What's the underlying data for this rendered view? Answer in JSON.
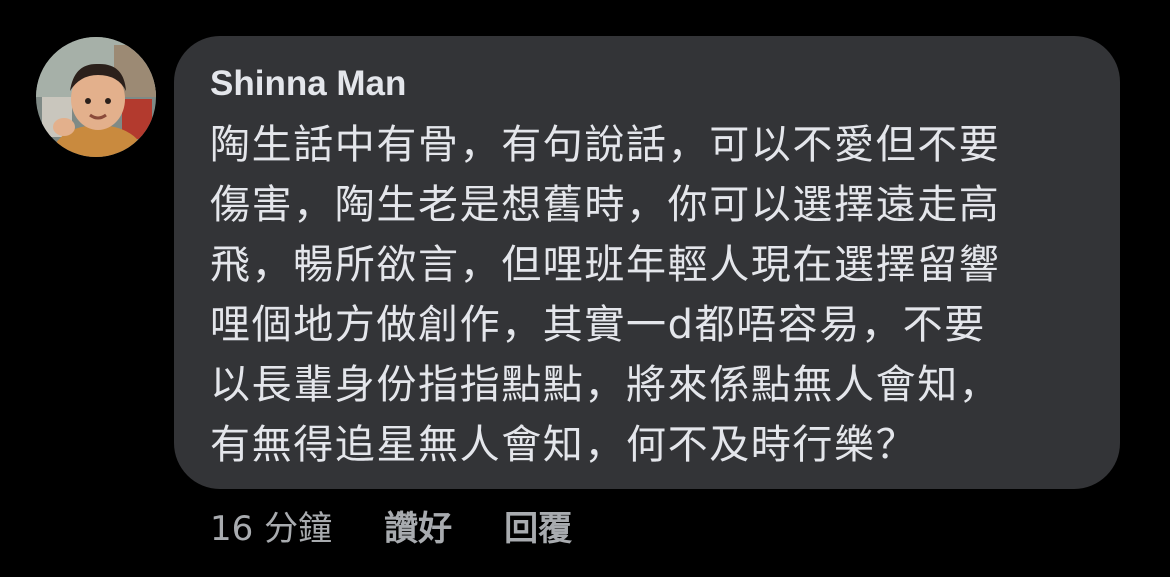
{
  "comment": {
    "author": "Shinna Man",
    "lines": [
      "陶生話中有骨，有句說話，可以不愛但不要",
      "傷害，陶生老是想舊時，你可以選擇遠走高",
      "飛，暢所欲言，但哩班年輕人現在選擇留響",
      "哩個地方做創作，其實一d都唔容易，不要",
      "以長輩身份指指點點，將來係點無人會知，",
      "有無得追星無人會知，何不及時行樂？"
    ],
    "time": "16 分鐘",
    "like_label": "讚好",
    "reply_label": "回覆"
  },
  "colors": {
    "background": "#000000",
    "bubble": "#333437",
    "text_primary": "#e4e6eb",
    "text_secondary": "#a8abaf"
  }
}
